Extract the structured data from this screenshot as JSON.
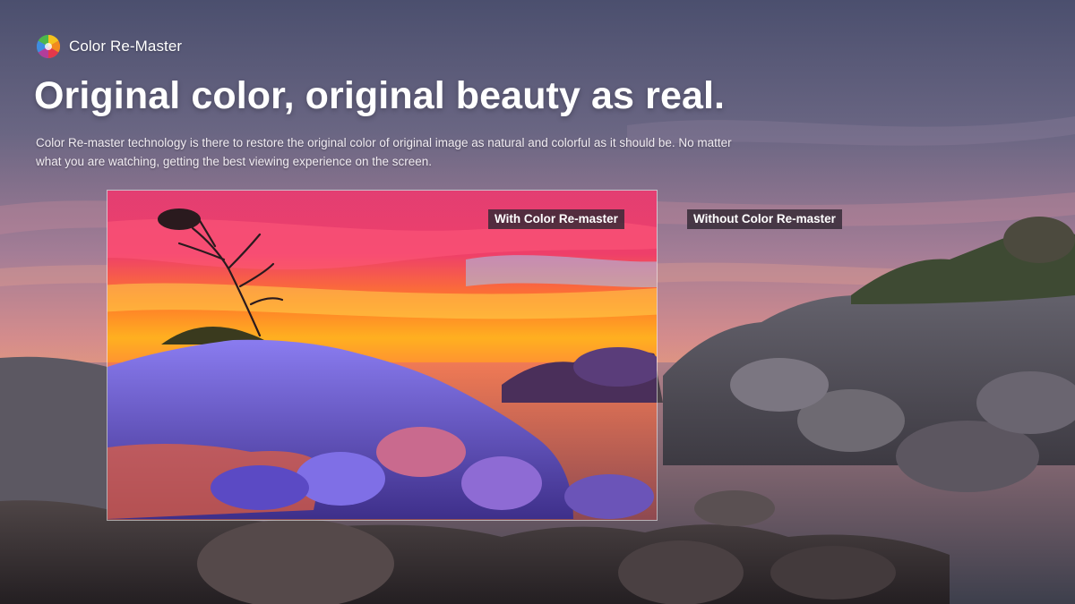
{
  "brand": {
    "name": "Color Re-Master",
    "logo_icon": "rainbow-aperture-icon"
  },
  "headline": "Original color, original beauty as real.",
  "description": "Color Re-master technology is there to restore the original color of original image as natural and colorful as it should be. No matter what you are watching, getting the best viewing experience on the screen.",
  "comparison": {
    "with_label": "With Color Re-master",
    "without_label": "Without Color Re-master"
  },
  "colors": {
    "sky_top": "#4f5475",
    "horizon_muted": "#d9907a",
    "sky_vivid_orange": "#ff8a1e",
    "sky_vivid_magenta": "#e0307a",
    "rock_vivid": "#6a5cd8",
    "label_bg": "#322834"
  }
}
